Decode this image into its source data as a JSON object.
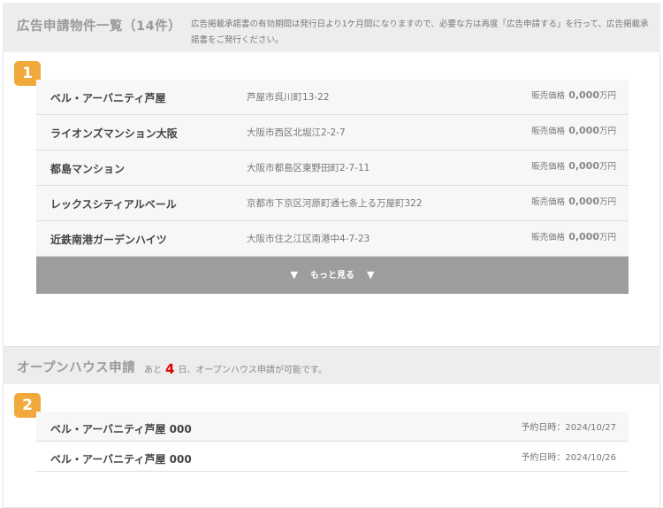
{
  "listings_section": {
    "title": "広告申請物件一覧（14件）",
    "notice": "広告掲載承諾書の有効期間は発行日より1ケ月間になりますので、必要な方は再度「広告申請する」を行って、広告掲載承諾書をご発行ください。",
    "badge": "1",
    "items": [
      {
        "name": "ベル・アーバニティ芦屋",
        "address": "芦屋市呉川町13-22",
        "price_label": "販売価格",
        "price_value": "0,000",
        "price_unit": "万円"
      },
      {
        "name": "ライオンズマンション大阪",
        "address": "大阪市西区北堀江2-2-7",
        "price_label": "販売価格",
        "price_value": "0,000",
        "price_unit": "万円"
      },
      {
        "name": "都島マンション",
        "address": "大阪市都島区東野田町2-7-11",
        "price_label": "販売価格",
        "price_value": "0,000",
        "price_unit": "万円"
      },
      {
        "name": "レックスシティアルベール",
        "address": "京都市下京区河原町通七条上る万屋町322",
        "price_label": "販売価格",
        "price_value": "0,000",
        "price_unit": "万円"
      },
      {
        "name": "近鉄南港ガーデンハイツ",
        "address": "大阪市住之江区南港中4-7-23",
        "price_label": "販売価格",
        "price_value": "0,000",
        "price_unit": "万円"
      }
    ],
    "more_button": {
      "icon_left": "▼",
      "label": "もっと見る",
      "icon_right": "▼"
    }
  },
  "openhouse_section": {
    "title": "オープンハウス申請",
    "sub_prefix": "あと",
    "days": "4",
    "sub_suffix": "日、オープンハウス申請が可能です。",
    "badge": "2",
    "items": [
      {
        "name": "ベル・アーバニティ芦屋 000",
        "date_label": "予約日時：2024/10/27"
      },
      {
        "name": "ベル・アーバニティ芦屋 000",
        "date_label": "予約日時：2024/10/26"
      }
    ]
  }
}
